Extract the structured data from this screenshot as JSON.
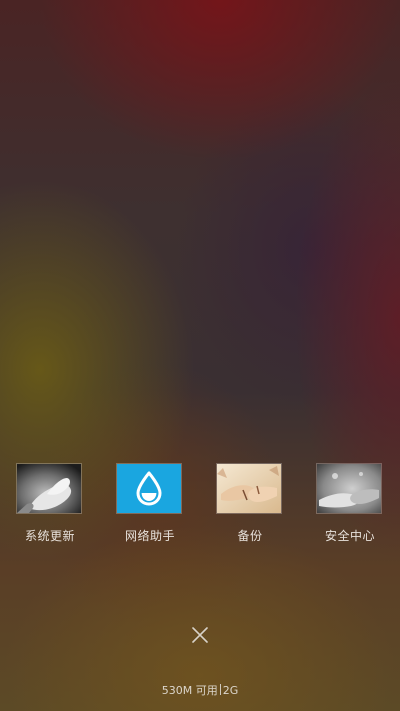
{
  "recent_apps": [
    {
      "label": "系统更新",
      "icon": "hands-photo-icon"
    },
    {
      "label": "网络助手",
      "icon": "water-drop-icon"
    },
    {
      "label": "备份",
      "icon": "holding-hands-photo-icon"
    },
    {
      "label": "安全中心",
      "icon": "handshake-photo-icon"
    }
  ],
  "close_button": {
    "icon": "close-icon"
  },
  "memory": {
    "available": "530M 可用",
    "total": "2G"
  },
  "colors": {
    "network_helper_accent": "#1aa6e0"
  }
}
